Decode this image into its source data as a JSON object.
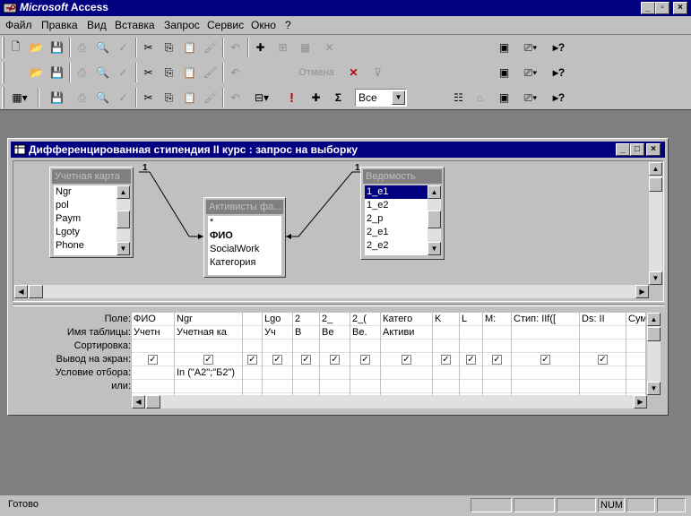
{
  "app": {
    "title_bold": "Microsoft",
    "title_rest": " Access"
  },
  "window_buttons": {
    "minimize": "_",
    "maximize": "▫",
    "close": "×"
  },
  "menu": [
    {
      "label": "Файл"
    },
    {
      "label": "Правка"
    },
    {
      "label": "Вид"
    },
    {
      "label": "Вставка"
    },
    {
      "label": "Запрос"
    },
    {
      "label": "Сервис"
    },
    {
      "label": "Окно"
    },
    {
      "label": "?"
    }
  ],
  "toolbar2": {
    "cancel_label": "Отмена"
  },
  "toolbar3": {
    "totals_symbol": "Σ",
    "top_values": "Все",
    "run_symbol": "!"
  },
  "query_window": {
    "title": "Дифференцированная стипендия II курс : запрос на выборку",
    "join_label_left": "1",
    "join_label_right": "1"
  },
  "tables": [
    {
      "name": "Учетная карта",
      "fields": [
        "Ngr",
        "pol",
        "Paym",
        "Lgoty",
        "Phone"
      ]
    },
    {
      "name": "Активисты фа...",
      "fields": [
        "*",
        "ФИО",
        "SocialWork",
        "Категория"
      ]
    },
    {
      "name": "Ведомость",
      "fields": [
        "1_e1",
        "1_e2",
        "2_p",
        "2_e1",
        "2_e2"
      ],
      "selected": 0
    }
  ],
  "grid": {
    "row_labels": [
      "Поле:",
      "Имя таблицы:",
      "Сортировка:",
      "Вывод на экран:",
      "Условие отбора:",
      "или:"
    ],
    "columns": [
      {
        "field": "ФИО",
        "table": "Учетн",
        "show": true,
        "criteria": ""
      },
      {
        "field": "Ngr",
        "table": "Учетная ка",
        "show": true,
        "criteria": "In (\"А2\";\"Б2\")"
      },
      {
        "field": "",
        "table": "",
        "show": true,
        "criteria": ""
      },
      {
        "field": "Lgo",
        "table": "Уч",
        "show": true,
        "criteria": ""
      },
      {
        "field": "2",
        "table": "В",
        "show": true,
        "criteria": ""
      },
      {
        "field": "2_",
        "table": "Ве",
        "show": true,
        "criteria": ""
      },
      {
        "field": "2_(",
        "table": "Ве.",
        "show": true,
        "criteria": ""
      },
      {
        "field": "Катего",
        "table": "Активи",
        "show": true,
        "criteria": ""
      },
      {
        "field": "K",
        "table": "",
        "show": true,
        "criteria": ""
      },
      {
        "field": "L",
        "table": "",
        "show": true,
        "criteria": ""
      },
      {
        "field": "M:",
        "table": "",
        "show": true,
        "criteria": ""
      },
      {
        "field": "Стип: IIf([",
        "table": "",
        "show": true,
        "criteria": ""
      },
      {
        "field": "Ds: II",
        "table": "",
        "show": true,
        "criteria": ""
      },
      {
        "field": "Сумм",
        "table": "",
        "show": true,
        "criteria": ""
      }
    ]
  },
  "status": {
    "text": "Готово",
    "num": "NUM"
  }
}
